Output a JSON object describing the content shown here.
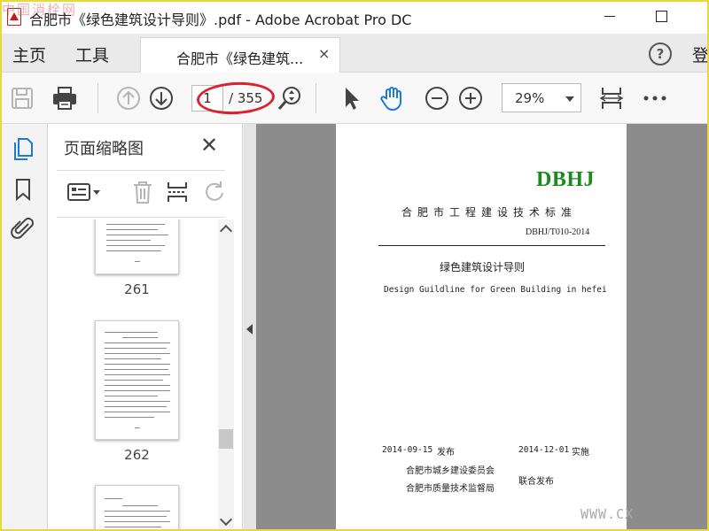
{
  "window": {
    "title": "合肥市《绿色建筑设计导则》.pdf - Adobe Acrobat Pro DC",
    "watermark_top": "中国消栓网",
    "watermark_bottom": "WWW.CX"
  },
  "nav": {
    "home": "主页",
    "tools": "工具",
    "doc_tab": "合肥市《绿色建筑...",
    "tab_close": "×",
    "help": "?",
    "login": "登"
  },
  "toolbar": {
    "current_page": "1",
    "total_pages": "/ 355",
    "zoom": "29%"
  },
  "panel": {
    "title": "页面缩略图",
    "close": "✕",
    "thumbnails": [
      {
        "page": "261"
      },
      {
        "page": "262"
      },
      {
        "page": ""
      }
    ]
  },
  "document": {
    "code": "DBHJ",
    "org": "合肥市工程建设技术标准",
    "number": "DBHJ/T010-2014",
    "title_cn": "绿色建筑设计导则",
    "title_en": "Design Guildline for Green Building in hefei",
    "publish_date": "2014-09-15",
    "publish_label": "发布",
    "implement_date": "2014-12-01",
    "implement_label": "实施",
    "issuer_1": "合肥市城乡建设委员会",
    "issuer_2": "合肥市质量技术监督局",
    "joint_label": "联合发布"
  },
  "colors": {
    "code_green": "#1a8a1a",
    "annotation_red": "#d9232d",
    "hand_tool_blue": "#1f7ad6",
    "frame_yellow": "#e8d93a"
  }
}
